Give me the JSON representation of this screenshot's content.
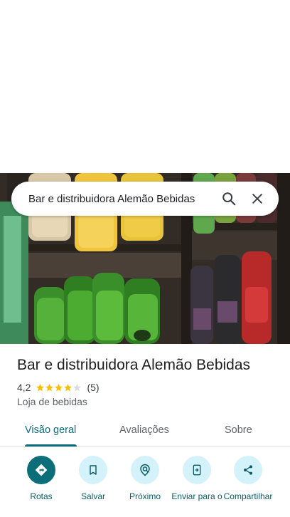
{
  "search": {
    "query": "Bar e distribuidora Alemão Bebidas",
    "search_icon": "search-icon",
    "close_icon": "close-icon"
  },
  "place": {
    "name": "Bar e distribuidora Alemão Bebidas",
    "rating": "4,2",
    "rating_value": 4.2,
    "stars_filled": 4,
    "stars_total": 5,
    "review_count": "(5)",
    "category": "Loja de bebidas"
  },
  "tabs": [
    {
      "label": "Visão geral",
      "active": true
    },
    {
      "label": "Avaliações",
      "active": false
    },
    {
      "label": "Sobre",
      "active": false
    }
  ],
  "actions": [
    {
      "label": "Rotas",
      "icon": "directions-icon"
    },
    {
      "label": "Salvar",
      "icon": "bookmark-icon"
    },
    {
      "label": "Próximo",
      "icon": "nearby-icon"
    },
    {
      "label": "Enviar para o",
      "icon": "send-to-phone-icon"
    },
    {
      "label": "Compartilhar",
      "icon": "share-icon"
    }
  ],
  "colors": {
    "accent": "#0b6e79",
    "action_bg": "#d4f2fa",
    "star": "#fbbc04",
    "star_empty": "#dadce0"
  }
}
